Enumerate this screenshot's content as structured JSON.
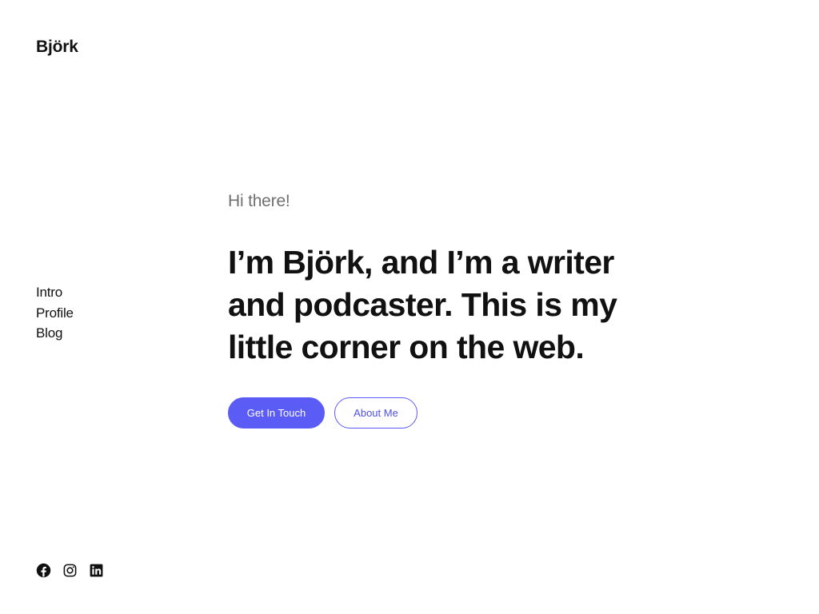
{
  "site": {
    "title": "Björk"
  },
  "nav": {
    "items": [
      {
        "label": "Intro"
      },
      {
        "label": "Profile"
      },
      {
        "label": "Blog"
      }
    ]
  },
  "hero": {
    "greeting": "Hi there!",
    "heading": "I’m Björk, and I’m a writer and podcaster. This is my little corner on the web.",
    "primary_button": "Get In Touch",
    "secondary_button": "About Me"
  },
  "social": {
    "icons": [
      "facebook-icon",
      "instagram-icon",
      "linkedin-icon"
    ]
  },
  "colors": {
    "accent": "#5b5cf6",
    "text": "#111111",
    "muted": "#707070",
    "background": "#ffffff"
  }
}
